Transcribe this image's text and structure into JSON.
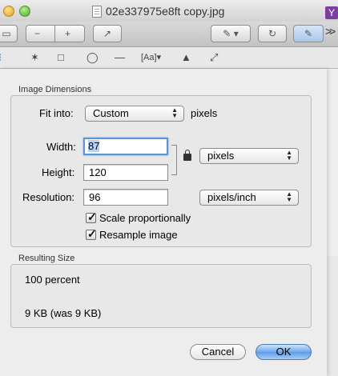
{
  "window": {
    "title": "02e337975e8ft copy.jpg",
    "badge": "Y"
  },
  "toolbar": {
    "zoom_out": "−",
    "zoom_in": "+",
    "share": "↗",
    "markup": "✎",
    "rotate": "↻",
    "edit": "✎",
    "more": ">>"
  },
  "sheet": {
    "image_dimensions": {
      "title": "Image Dimensions",
      "fit_into_label": "Fit into:",
      "fit_into_value": "Custom",
      "fit_into_unit": "pixels",
      "width_label": "Width:",
      "width_value": "87",
      "height_label": "Height:",
      "height_value": "120",
      "size_unit": "pixels",
      "resolution_label": "Resolution:",
      "resolution_value": "96",
      "resolution_unit": "pixels/inch",
      "scale_label": "Scale proportionally",
      "scale_checked": true,
      "resample_label": "Resample image",
      "resample_checked": true
    },
    "resulting_size": {
      "title": "Resulting Size",
      "percent": "100 percent",
      "filesize": "9 KB (was 9 KB)"
    },
    "cancel_label": "Cancel",
    "ok_label": "OK"
  }
}
